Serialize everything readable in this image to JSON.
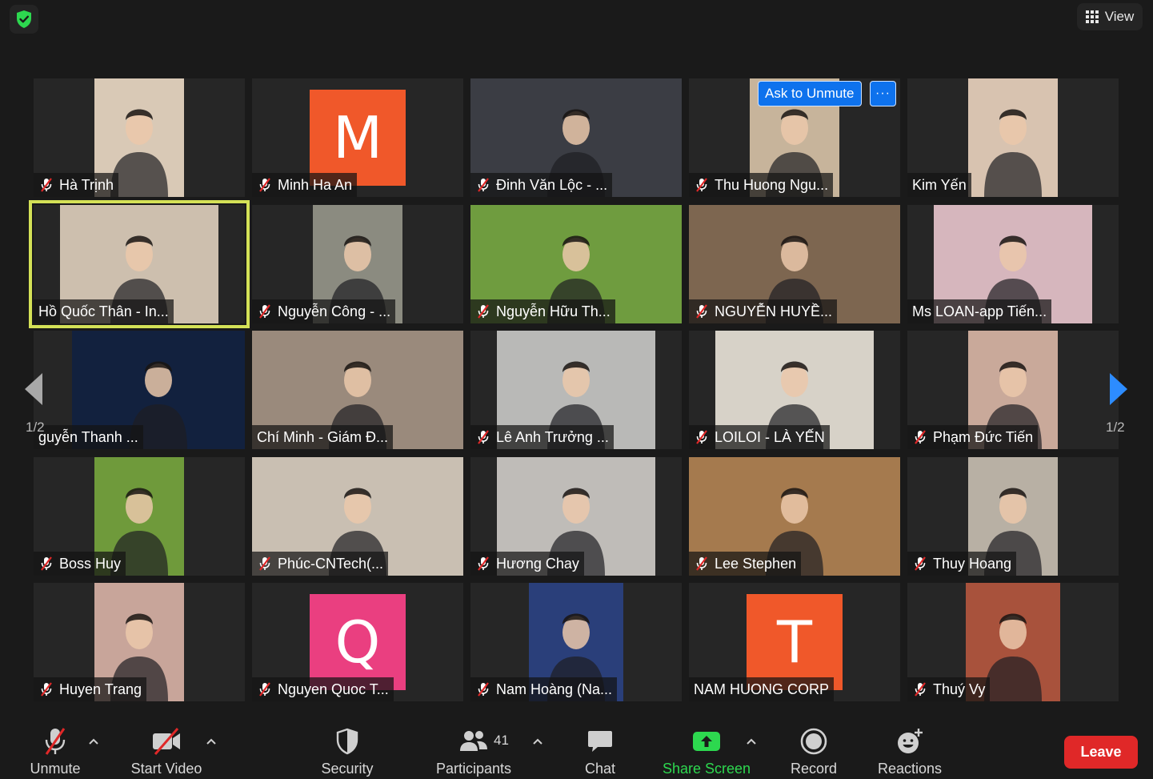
{
  "window": {
    "view_label": "View"
  },
  "participants": [
    {
      "name": "Hà Trịnh",
      "muted": true,
      "video": true,
      "vx": 76,
      "vw": 112,
      "bg": "#d9c9b6"
    },
    {
      "name": "Minh Ha An",
      "muted": true,
      "video": false,
      "initial": "M",
      "avatar_color": "#f0582a"
    },
    {
      "name": "Đinh Văn Lộc - ...",
      "muted": true,
      "video": true,
      "vx": 0,
      "vw": 264,
      "bg": "#3b3d44"
    },
    {
      "name": "Thu Huong Ngu...",
      "muted": true,
      "video": true,
      "vx": 76,
      "vw": 112,
      "bg": "#c7b49b"
    },
    {
      "name": "Kim Yến",
      "muted": false,
      "video": true,
      "vx": 76,
      "vw": 112,
      "bg": "#d8c3b0"
    },
    {
      "name": "Hồ Quốc Thân - In...",
      "muted": false,
      "video": true,
      "vx": 33,
      "vw": 198,
      "bg": "#cdbfae"
    },
    {
      "name": "Nguyễn Công - ...",
      "muted": true,
      "video": true,
      "vx": 76,
      "vw": 112,
      "bg": "#8b8b80"
    },
    {
      "name": "Nguyễn Hữu Th...",
      "muted": true,
      "video": true,
      "vx": 0,
      "vw": 264,
      "bg": "#6f9c3f"
    },
    {
      "name": "NGUYỄN HUYỀ...",
      "muted": true,
      "video": true,
      "vx": 0,
      "vw": 264,
      "bg": "#7d6650"
    },
    {
      "name": "Ms LOAN-app Tiến...",
      "muted": false,
      "video": true,
      "vx": 33,
      "vw": 198,
      "bg": "#d6b6bd"
    },
    {
      "name": "guyễn Thanh ...",
      "muted": false,
      "video": true,
      "vx": 48,
      "vw": 216,
      "bg": "#12213e"
    },
    {
      "name": "Chí Minh - Giám Đ...",
      "muted": false,
      "video": true,
      "vx": 0,
      "vw": 264,
      "bg": "#9a8a7c"
    },
    {
      "name": "Lê Anh Trưởng ...",
      "muted": true,
      "video": true,
      "vx": 33,
      "vw": 198,
      "bg": "#b9b9b7"
    },
    {
      "name": "LOILOI - LÀ YẾN",
      "muted": true,
      "video": true,
      "vx": 33,
      "vw": 198,
      "bg": "#d7d2c8"
    },
    {
      "name": "Phạm Đức Tiến",
      "muted": true,
      "video": true,
      "vx": 76,
      "vw": 112,
      "bg": "#c9a99a"
    },
    {
      "name": "Boss Huy",
      "muted": true,
      "video": true,
      "vx": 76,
      "vw": 112,
      "bg": "#6f9a3b"
    },
    {
      "name": "Phúc-CNTech(...",
      "muted": true,
      "video": true,
      "vx": 0,
      "vw": 264,
      "bg": "#c9bfb2"
    },
    {
      "name": "Hương Chay",
      "muted": true,
      "video": true,
      "vx": 33,
      "vw": 198,
      "bg": "#bfbcb8"
    },
    {
      "name": "Lee Stephen",
      "muted": true,
      "video": true,
      "vx": 0,
      "vw": 264,
      "bg": "#a57a4e"
    },
    {
      "name": "Thuy Hoang",
      "muted": true,
      "video": true,
      "vx": 76,
      "vw": 112,
      "bg": "#b8b0a4"
    },
    {
      "name": "Huyen Trang",
      "muted": true,
      "video": true,
      "vx": 76,
      "vw": 112,
      "bg": "#c8a59a"
    },
    {
      "name": "Nguyen Quoc T...",
      "muted": true,
      "video": false,
      "initial": "Q",
      "avatar_color": "#ea3f80"
    },
    {
      "name": "Nam Hoàng (Na...",
      "muted": true,
      "video": true,
      "vx": 73,
      "vw": 118,
      "bg": "#2a3f7a"
    },
    {
      "name": "NAM HUONG CORP",
      "muted": false,
      "video": false,
      "initial": "T",
      "avatar_color": "#f0582a"
    },
    {
      "name": "Thuý Vy",
      "muted": true,
      "video": true,
      "vx": 73,
      "vw": 118,
      "bg": "#a8523c"
    }
  ],
  "active_speaker_index": 5,
  "ask_to_unmute": {
    "label": "Ask to Unmute",
    "more": "···"
  },
  "pagination": {
    "left_label": "1/2",
    "right_label": "1/2"
  },
  "toolbar": {
    "unmute": "Unmute",
    "start_video": "Start Video",
    "security": "Security",
    "participants": "Participants",
    "participants_count": "41",
    "chat": "Chat",
    "share_screen": "Share Screen",
    "record": "Record",
    "reactions": "Reactions",
    "leave": "Leave"
  },
  "colors": {
    "accent_green": "#2dd84f",
    "leave_red": "#e02828",
    "highlight": "#d4e157",
    "blue": "#0e72ed"
  }
}
